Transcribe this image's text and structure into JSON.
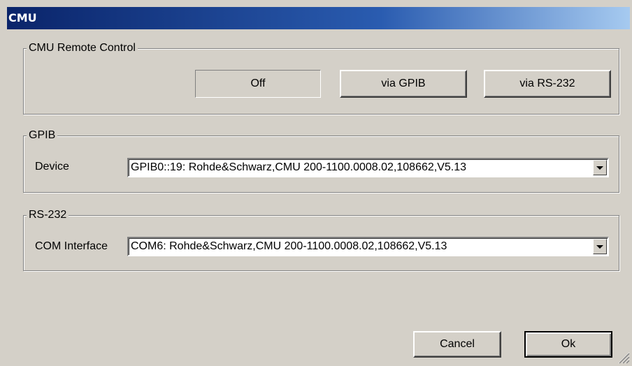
{
  "window": {
    "title": "CMU"
  },
  "remote_control": {
    "title": "CMU Remote Control",
    "buttons": {
      "off": "Off",
      "gpib": "via GPIB",
      "rs232": "via RS-232"
    }
  },
  "gpib": {
    "title": "GPIB",
    "device_label": "Device",
    "device_value": "GPIB0::19: Rohde&Schwarz,CMU 200-1100.0008.02,108662,V5.13"
  },
  "rs232": {
    "title": "RS-232",
    "com_label": "COM Interface",
    "com_value": "COM6: Rohde&Schwarz,CMU 200-1100.0008.02,108662,V5.13"
  },
  "footer": {
    "cancel": "Cancel",
    "ok": "Ok"
  }
}
